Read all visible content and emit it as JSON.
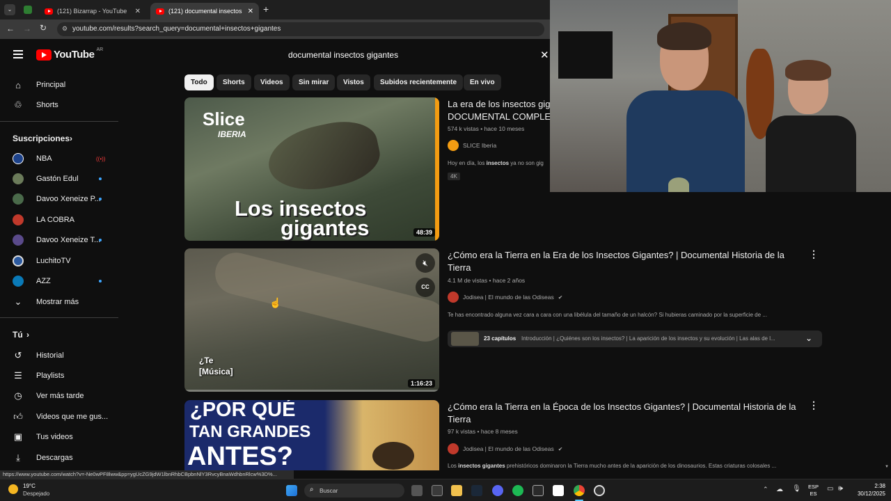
{
  "browser": {
    "tabs": [
      {
        "label": "(121) Bizarrap - YouTube"
      },
      {
        "label": "(121) documental insectos gig..."
      }
    ],
    "url": "youtube.com/results?search_query=documental+insectos+gigantes"
  },
  "header": {
    "logo_text": "YouTube",
    "country": "AR",
    "search_value": "documental insectos gigantes"
  },
  "sidebar": {
    "main": [
      {
        "label": "Principal",
        "icon": "home-icon"
      },
      {
        "label": "Shorts",
        "icon": "shorts-icon"
      }
    ],
    "subscriptions_title": "Suscripciones",
    "subscriptions": [
      {
        "label": "NBA",
        "color": "#1d428a"
      },
      {
        "label": "Gastón Edul",
        "color": "#6b7b5a"
      },
      {
        "label": "Davoo Xeneize P...",
        "color": "#4a6a4a"
      },
      {
        "label": "LA COBRA",
        "color": "#c0392b"
      },
      {
        "label": "Davoo Xeneize T...",
        "color": "#5a4a8a"
      },
      {
        "label": "LuchitoTV",
        "color": "#2c5aa0"
      },
      {
        "label": "AZZ",
        "color": "#0a7ab8"
      }
    ],
    "show_more": "Mostrar más",
    "you_title": "Tú",
    "you_items": [
      {
        "label": "Historial",
        "icon": "history-icon"
      },
      {
        "label": "Playlists",
        "icon": "playlists-icon"
      },
      {
        "label": "Ver más tarde",
        "icon": "watch-later-icon"
      },
      {
        "label": "Videos que me gus...",
        "icon": "like-icon"
      },
      {
        "label": "Tus videos",
        "icon": "your-videos-icon"
      },
      {
        "label": "Descargas",
        "icon": "download-icon"
      }
    ]
  },
  "chips": [
    "Todo",
    "Shorts",
    "Videos",
    "Sin mirar",
    "Vistos",
    "Subidos recientemente",
    "En vivo"
  ],
  "results": [
    {
      "title": "La era de los insectos gig",
      "title2": "DOCUMENTAL COMPLET",
      "meta": "574 k vistas • hace 10 meses",
      "channel": "SLICE Iberia",
      "desc_pre": "Hoy en día, los ",
      "desc_bold": "insectos",
      "desc_post": " ya no son gig",
      "badge": "4K",
      "duration": "48:39",
      "thumb_brand": "Slice",
      "thumb_brand2": "IBERIA",
      "thumb_title1": "Los insectos",
      "thumb_title2": "gigantes"
    },
    {
      "title": "¿Cómo era la Tierra en la Era de los Insectos Gigantes? | Documental Historia de la Tierra",
      "meta": "4.1 M de vistas • hace 2 años",
      "channel": "Jodisea | El mundo de las Odiseas",
      "desc": "Te has encontrado alguna vez cara a cara con una libélula del tamaño de un halcón? Si hubieras caminado por la superficie de ...",
      "chapters_count": "23 capítulos",
      "chapters_text": "Introducción | ¿Quiénes son los insectos? | La aparición de los insectos y su evolución | Las alas de l...",
      "duration": "1:16:23",
      "caption": "¿Te\n[Música]"
    },
    {
      "title": "¿Cómo era la Tierra en la Época de los Insectos Gigantes? | Documental Historia de la Tierra",
      "meta": "97 k vistas • hace 8 meses",
      "channel": "Jodisea | El mundo de las Odiseas",
      "desc_pre": "Los ",
      "desc_bold": "insectos gigantes",
      "desc_post": " prehistóricos dominaron la Tierra mucho antes de la aparición de los dinosaurios. Estas criaturas colosales ...",
      "thumb_l1": "¿POR QUÉ",
      "thumb_l2": "TAN GRANDES",
      "thumb_l3": "ANTES?"
    }
  ],
  "status_url": "https://www.youtube.com/watch?v=-Ne0wPF8lww&pp=ygUcZG9jdW1lbnRhbCBpbnNlY3RvcyBnaWdhbnRlcw%3D%...",
  "taskbar": {
    "temp": "19°C",
    "weather": "Despejado",
    "search_placeholder": "Buscar",
    "lang": "ESP",
    "lang2": "ES",
    "time": "2:38",
    "date": "30/12/2025"
  }
}
